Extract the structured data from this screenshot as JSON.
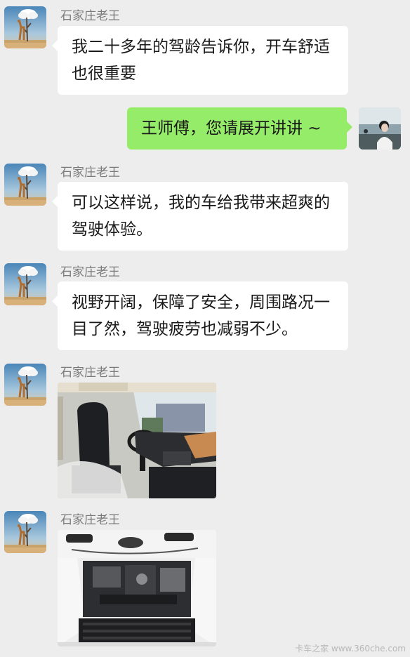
{
  "messages": [
    {
      "sender": "石家庄老王",
      "side": "left",
      "type": "text",
      "text": "我二十多年的驾龄告诉你，开车舒适也很重要"
    },
    {
      "sender": "",
      "side": "right",
      "type": "text",
      "text": "王师傅，您请展开讲讲 ~"
    },
    {
      "sender": "石家庄老王",
      "side": "left",
      "type": "text",
      "text": "可以这样说，我的车给我带来超爽的驾驶体验。"
    },
    {
      "sender": "石家庄老王",
      "side": "left",
      "type": "text",
      "text": "视野开阔，保障了安全，周围路况一目了然，驾驶疲劳也减弱不少。"
    },
    {
      "sender": "石家庄老王",
      "side": "left",
      "type": "image",
      "image": "truck-cab-interior-photo"
    },
    {
      "sender": "石家庄老王",
      "side": "left",
      "type": "image",
      "image": "truck-engine-bay-photo"
    }
  ],
  "watermark": "卡车之家 www.360che.com"
}
